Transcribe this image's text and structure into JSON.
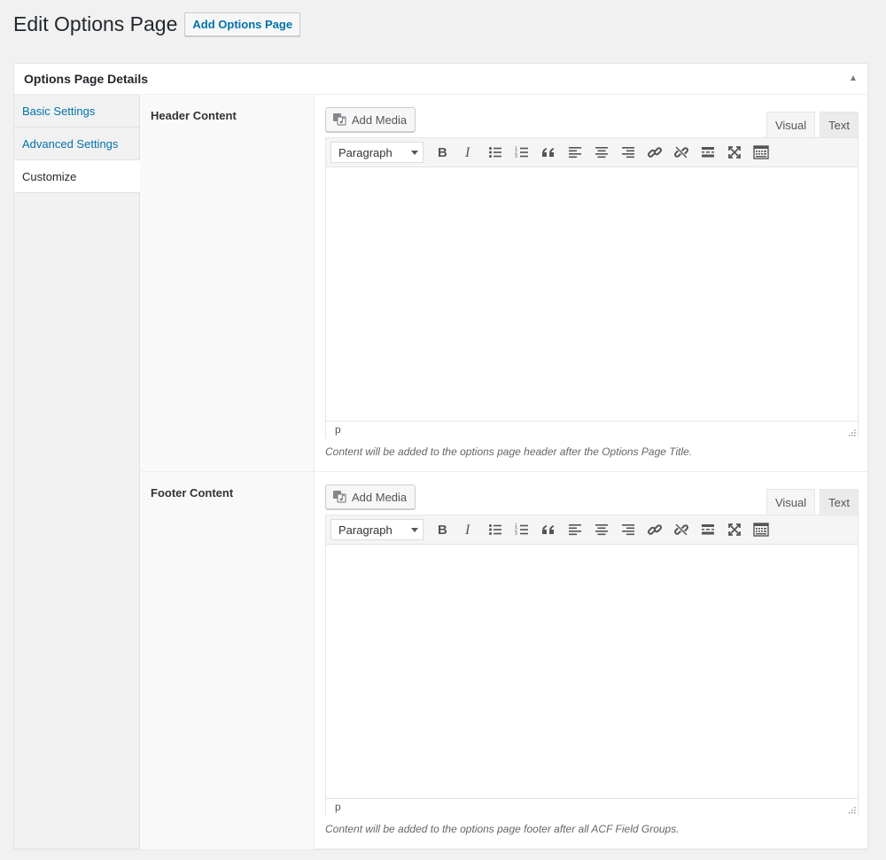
{
  "page": {
    "title": "Edit Options Page",
    "add_button": "Add Options Page"
  },
  "postbox": {
    "title": "Options Page Details"
  },
  "tabs": [
    {
      "label": "Basic Settings",
      "active": false
    },
    {
      "label": "Advanced Settings",
      "active": false
    },
    {
      "label": "Customize",
      "active": true
    }
  ],
  "fields": [
    {
      "label": "Header Content",
      "add_media": "Add Media",
      "visual_tab": "Visual",
      "text_tab": "Text",
      "format": "Paragraph",
      "status_path": "p",
      "instructions": "Content will be added to the options page header after the Options Page Title."
    },
    {
      "label": "Footer Content",
      "add_media": "Add Media",
      "visual_tab": "Visual",
      "text_tab": "Text",
      "format": "Paragraph",
      "status_path": "p",
      "instructions": "Content will be added to the options page footer after all ACF Field Groups."
    }
  ],
  "toolbar_icons": [
    "bold-icon",
    "italic-icon",
    "bullet-list-icon",
    "numbered-list-icon",
    "blockquote-icon",
    "align-left-icon",
    "align-center-icon",
    "align-right-icon",
    "link-icon",
    "unlink-icon",
    "read-more-icon",
    "fullscreen-icon",
    "toolbar-toggle-icon"
  ],
  "colors": {
    "link": "#0073aa",
    "background": "#f1f1f1"
  }
}
